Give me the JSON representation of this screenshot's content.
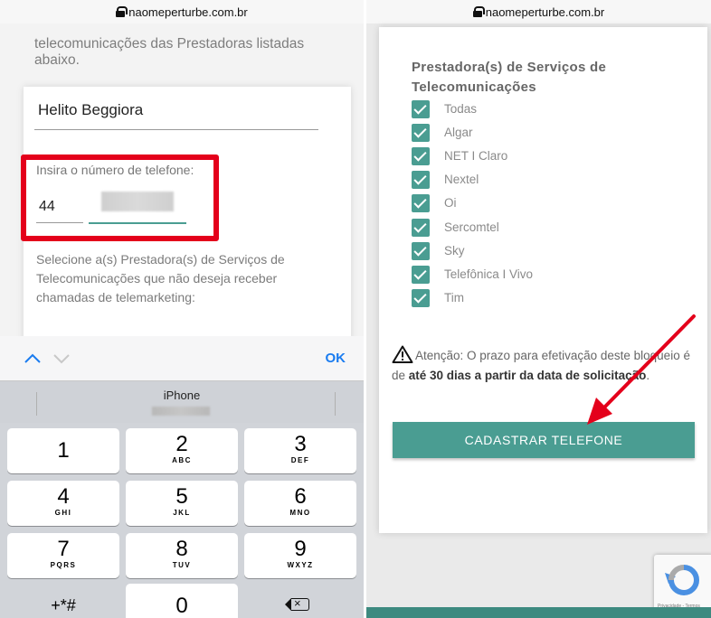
{
  "left": {
    "url": "naomeperturbe.com.br",
    "intro_text": "telecomunicações das Prestadoras listadas abaixo.",
    "name_value": "Helito Beggiora",
    "phone_label": "Insira o número de telefone:",
    "ddd_value": "44",
    "select_text": "Selecione a(s) Prestadora(s) de Serviços de Telecomunicações que não deseja receber chamadas de telemarketing:",
    "keyboard": {
      "up_icon": "chevron-up-icon",
      "down_icon": "chevron-down-icon",
      "ok_label": "OK",
      "suggestion": "iPhone",
      "keys": [
        {
          "digit": "1",
          "letters": ""
        },
        {
          "digit": "2",
          "letters": "ABC"
        },
        {
          "digit": "3",
          "letters": "DEF"
        },
        {
          "digit": "4",
          "letters": "GHI"
        },
        {
          "digit": "5",
          "letters": "JKL"
        },
        {
          "digit": "6",
          "letters": "MNO"
        },
        {
          "digit": "7",
          "letters": "PQRS"
        },
        {
          "digit": "8",
          "letters": "TUV"
        },
        {
          "digit": "9",
          "letters": "WXYZ"
        },
        {
          "digit": "+*#",
          "letters": ""
        },
        {
          "digit": "0",
          "letters": ""
        }
      ],
      "backspace_icon": "backspace-icon"
    }
  },
  "right": {
    "url": "naomeperturbe.com.br",
    "prest_title": "Prestadora(s) de Serviços de Telecomunicações",
    "options": [
      {
        "label": "Todas",
        "checked": true
      },
      {
        "label": "Algar",
        "checked": true
      },
      {
        "label": "NET I Claro",
        "checked": true
      },
      {
        "label": "Nextel",
        "checked": true
      },
      {
        "label": "Oi",
        "checked": true
      },
      {
        "label": "Sercomtel",
        "checked": true
      },
      {
        "label": "Sky",
        "checked": true
      },
      {
        "label": "Telefônica I Vivo",
        "checked": true
      },
      {
        "label": "Tim",
        "checked": true
      }
    ],
    "warning_prefix": "Atenção: O prazo para efetivação deste bloqueio é de ",
    "warning_bold": "até 30 dias a partir da data de solicitação",
    "warning_suffix": ".",
    "submit_label": "CADASTRAR TELEFONE",
    "recaptcha_label": "Privacidade - Termos"
  },
  "colors": {
    "accent": "#4a9d92",
    "highlight": "#e4001b",
    "ios_blue": "#1a7cf0"
  }
}
